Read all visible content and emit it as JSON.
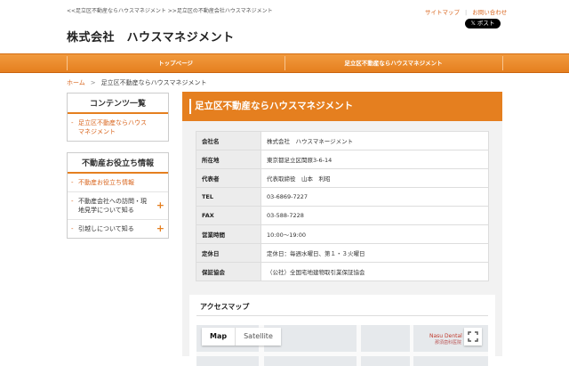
{
  "header": {
    "breadcrumb_top": "<<足立区不動産ならハウスマネジメント >>足立区の不動産会社ハウスマネジメント",
    "sitemap_link": "サイトマップ",
    "contact_link": "お問い合わせ",
    "x_post_label": "𝕏 ポスト",
    "site_title": "株式会社　ハウスマネジメント"
  },
  "nav": {
    "items": [
      "トップページ",
      "足立区不動産ならハウスマネジメント"
    ]
  },
  "breadcrumb": {
    "home": "ホーム",
    "sep": ">",
    "current": "足立区不動産ならハウスマネジメント"
  },
  "sidebar": {
    "contents_title": "コンテンツ一覧",
    "contents_items": [
      "足立区不動産ならハウスマネジメント"
    ],
    "info_title": "不動産お役立ち情報",
    "info_items": [
      "不動産お役立ち情報",
      "不動産会社への訪問・現地見学について知る",
      "引越しについて知る"
    ]
  },
  "main": {
    "heading": "足立区不動産ならハウスマネジメント",
    "table": [
      {
        "label": "会社名",
        "value": "株式会社　ハウスマネージメント"
      },
      {
        "label": "所在地",
        "value": "東京都足立区関原3-6-14"
      },
      {
        "label": "代表者",
        "value": "代表取締役　山本　利昭"
      },
      {
        "label": "TEL",
        "value": "03-6869-7227"
      },
      {
        "label": "FAX",
        "value": "03-588-7228"
      },
      {
        "label": "営業時間",
        "value": "10:00〜19:00"
      },
      {
        "label": "定休日",
        "value": "定休日：毎週水曜日、第１・３火曜日"
      },
      {
        "label": "保証協会",
        "value": "（公社）全国宅地建物取引業保証協会"
      }
    ],
    "access_title": "アクセスマップ",
    "map": {
      "tab_map": "Map",
      "tab_satellite": "Satellite",
      "poi_label": "Nasu Dental Cl",
      "poi_sub": "那須歯科医院"
    }
  },
  "colors": {
    "accent": "#e57f1f",
    "panel": "#f2f2f2"
  }
}
